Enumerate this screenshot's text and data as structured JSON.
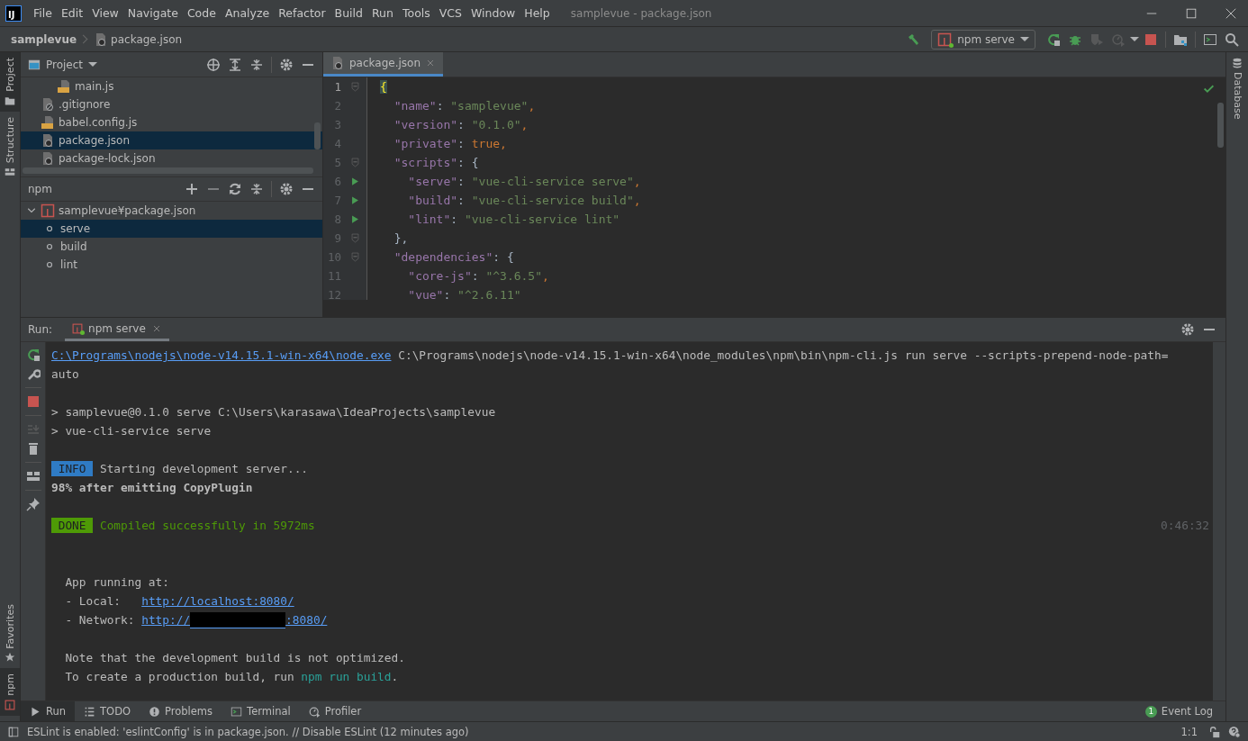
{
  "menu_bar": {
    "logo": "IJ",
    "items": [
      "File",
      "Edit",
      "View",
      "Navigate",
      "Code",
      "Analyze",
      "Refactor",
      "Build",
      "Run",
      "Tools",
      "VCS",
      "Window",
      "Help"
    ],
    "title": "samplevue - package.json"
  },
  "nav_bar": {
    "breadcrumbs": [
      {
        "label": "samplevue",
        "kind": "project"
      },
      {
        "label": "package.json",
        "kind": "json"
      }
    ],
    "run_config": "npm serve",
    "toolbar": [
      {
        "kind": "rerun",
        "disabled": false
      },
      {
        "kind": "debug",
        "disabled": false
      },
      {
        "kind": "coverage",
        "disabled": true
      },
      {
        "kind": "profile",
        "disabled": true
      },
      {
        "kind": "caret",
        "disabled": false
      },
      {
        "kind": "stop",
        "disabled": false
      },
      {
        "kind": "structure",
        "disabled": false
      },
      {
        "kind": "terminal",
        "disabled": false
      },
      {
        "kind": "search",
        "disabled": false
      }
    ]
  },
  "left_strip": [
    {
      "label": "Project",
      "kind": "folder",
      "selected": true
    },
    {
      "label": "Structure",
      "kind": "structure",
      "selected": false
    },
    {
      "label": "Favorites",
      "kind": "star",
      "selected": false
    },
    {
      "label": "npm",
      "kind": "npm",
      "selected": true
    }
  ],
  "right_strip": [
    {
      "label": "Database",
      "kind": "database",
      "selected": false
    }
  ],
  "project_pane": {
    "title": "Project",
    "tree": [
      {
        "children": [
          {
            "label": "main.js",
            "kind": "js",
            "selected": false
          }
        ]
      },
      {
        "label": ".gitignore",
        "kind": "ignore",
        "selected": false
      },
      {
        "label": "babel.config.js",
        "kind": "js",
        "selected": false
      },
      {
        "label": "package.json",
        "kind": "json",
        "selected": true
      },
      {
        "label": "package-lock.json",
        "kind": "json",
        "selected": false
      }
    ]
  },
  "npm_pane": {
    "title": "npm",
    "tree": [
      {
        "label": "samplevue¥package.json",
        "kind": "npm",
        "expanded": true,
        "selected": false,
        "children": [
          {
            "label": "serve",
            "kind": "script",
            "selected": true
          },
          {
            "label": "build",
            "kind": "script",
            "selected": false
          },
          {
            "label": "lint",
            "kind": "script",
            "selected": false
          }
        ]
      }
    ]
  },
  "editor": {
    "tabs": [
      {
        "label": "package.json",
        "selected": true
      }
    ],
    "lines": [
      {
        "number": "1",
        "kind": "fold",
        "tokens": [
          {
            "text": "{",
            "kind": "brace"
          }
        ]
      },
      {
        "number": "2",
        "tokens": [
          {
            "text": "  \"name\"",
            "kind": "key"
          },
          {
            "text": ": ",
            "kind": "punct"
          },
          {
            "text": "\"samplevue\"",
            "kind": "string"
          },
          {
            "text": ",",
            "kind": "keyword"
          }
        ]
      },
      {
        "number": "3",
        "tokens": [
          {
            "text": "  \"version\"",
            "kind": "key"
          },
          {
            "text": ": ",
            "kind": "punct"
          },
          {
            "text": "\"0.1.0\"",
            "kind": "string"
          },
          {
            "text": ",",
            "kind": "keyword"
          }
        ]
      },
      {
        "number": "4",
        "tokens": [
          {
            "text": "  \"private\"",
            "kind": "key"
          },
          {
            "text": ": ",
            "kind": "punct"
          },
          {
            "text": "true,",
            "kind": "keyword"
          }
        ]
      },
      {
        "number": "5",
        "kind": "fold",
        "tokens": [
          {
            "text": "  \"scripts\"",
            "kind": "key"
          },
          {
            "text": ": {",
            "kind": "punct"
          }
        ]
      },
      {
        "number": "6",
        "kind": "run",
        "tokens": [
          {
            "text": "    \"serve\"",
            "kind": "key"
          },
          {
            "text": ": ",
            "kind": "punct"
          },
          {
            "text": "\"vue-cli-service serve\"",
            "kind": "string"
          },
          {
            "text": ",",
            "kind": "keyword"
          }
        ]
      },
      {
        "number": "7",
        "kind": "run",
        "tokens": [
          {
            "text": "    \"build\"",
            "kind": "key"
          },
          {
            "text": ": ",
            "kind": "punct"
          },
          {
            "text": "\"vue-cli-service build\"",
            "kind": "string"
          },
          {
            "text": ",",
            "kind": "keyword"
          }
        ]
      },
      {
        "number": "8",
        "kind": "run",
        "tokens": [
          {
            "text": "    \"lint\"",
            "kind": "key"
          },
          {
            "text": ": ",
            "kind": "punct"
          },
          {
            "text": "\"vue-cli-service lint\"",
            "kind": "string"
          }
        ]
      },
      {
        "number": "9",
        "kind": "fold",
        "tokens": [
          {
            "text": "  },",
            "kind": "punct"
          }
        ]
      },
      {
        "number": "10",
        "kind": "fold",
        "tokens": [
          {
            "text": "  \"dependencies\"",
            "kind": "key"
          },
          {
            "text": ": {",
            "kind": "punct"
          }
        ]
      },
      {
        "number": "11",
        "tokens": [
          {
            "text": "    \"core-js\"",
            "kind": "key"
          },
          {
            "text": ": ",
            "kind": "punct"
          },
          {
            "text": "\"^3.6.5\"",
            "kind": "string"
          },
          {
            "text": ",",
            "kind": "keyword"
          }
        ]
      },
      {
        "number": "12",
        "tokens": [
          {
            "text": "    \"vue\"",
            "kind": "key"
          },
          {
            "text": ": ",
            "kind": "punct"
          },
          {
            "text": "\"^2.6.11\"",
            "kind": "string"
          }
        ]
      }
    ]
  },
  "run_panel": {
    "label": "Run:",
    "tabs": [
      {
        "label": "npm serve",
        "selected": true
      }
    ],
    "toolbar": [
      {
        "kind": "rerun",
        "disabled": false
      },
      {
        "kind": "wrench",
        "disabled": false
      },
      {
        "kind": "stop",
        "disabled": false
      },
      {
        "kind": "scroll-end",
        "disabled": true
      },
      {
        "kind": "trash",
        "disabled": false
      },
      {
        "kind": "layout",
        "disabled": false
      },
      {
        "kind": "pin",
        "disabled": false
      }
    ],
    "lines": [
      {
        "segments": [
          {
            "text": "C:\\Programs\\nodejs\\node-v14.15.1-win-x64\\node.exe",
            "kind": "link"
          },
          {
            "text": " C:\\Programs\\nodejs\\node-v14.15.1-win-x64\\node_modules\\npm\\bin\\npm-cli.js run serve --scripts-prepend-node-path=",
            "kind": "plain"
          }
        ]
      },
      {
        "segments": [
          {
            "text": "auto",
            "kind": "plain"
          }
        ]
      },
      {
        "kind": "blank"
      },
      {
        "segments": [
          {
            "text": "> samplevue@0.1.0 serve C:\\Users\\karasawa\\IdeaProjects\\samplevue",
            "kind": "plain"
          }
        ]
      },
      {
        "segments": [
          {
            "text": "> vue-cli-service serve",
            "kind": "plain"
          }
        ]
      },
      {
        "kind": "blank"
      },
      {
        "segments": [
          {
            "text": " INFO ",
            "kind": "info-badge"
          },
          {
            "text": " Starting development server...",
            "kind": "plain"
          }
        ]
      },
      {
        "segments": [
          {
            "text": "98% after emitting CopyPlugin",
            "kind": "bold"
          }
        ]
      },
      {
        "kind": "blank"
      },
      {
        "segments": [
          {
            "text": " DONE ",
            "kind": "done-badge"
          },
          {
            "text": " Compiled successfully in 5972ms",
            "kind": "success"
          },
          {
            "text": "0:46:32",
            "kind": "time"
          }
        ]
      },
      {
        "kind": "blank"
      },
      {
        "kind": "blank"
      },
      {
        "segments": [
          {
            "text": "  App running at:",
            "kind": "plain"
          }
        ]
      },
      {
        "segments": [
          {
            "text": "  - Local:   ",
            "kind": "plain"
          },
          {
            "text": "http://localhost:8080/",
            "kind": "link"
          }
        ]
      },
      {
        "segments": [
          {
            "text": "  - Network: ",
            "kind": "plain"
          },
          {
            "text": "http://",
            "kind": "link"
          },
          {
            "kind": "redacted"
          },
          {
            "text": ":8080/",
            "kind": "link"
          }
        ]
      },
      {
        "kind": "blank"
      },
      {
        "segments": [
          {
            "text": "  Note that the development build is not optimized.",
            "kind": "plain"
          }
        ]
      },
      {
        "segments": [
          {
            "text": "  To create a production build, run ",
            "kind": "plain"
          },
          {
            "text": "npm run build",
            "kind": "command"
          },
          {
            "text": ".",
            "kind": "plain"
          }
        ]
      }
    ]
  },
  "tool_tabs": [
    {
      "label": "Run",
      "kind": "run",
      "selected": true
    },
    {
      "label": "TODO",
      "kind": "list",
      "selected": false
    },
    {
      "label": "Problems",
      "kind": "problems",
      "selected": false
    },
    {
      "label": "Terminal",
      "kind": "terminal",
      "selected": false
    },
    {
      "label": "Profiler",
      "kind": "profiler",
      "selected": false
    }
  ],
  "event_log": {
    "label": "Event Log",
    "count": "1"
  },
  "status_bar": {
    "message": "ESLint is enabled: 'eslintConfig' is in package.json. // Disable ESLint (12 minutes ago)",
    "position": "1:1"
  }
}
